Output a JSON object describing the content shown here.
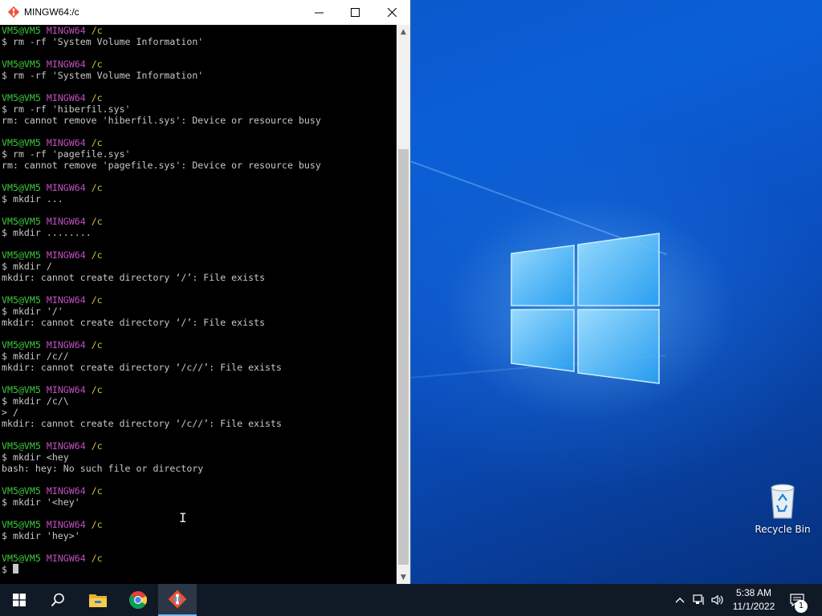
{
  "window": {
    "title": "MINGW64:/c",
    "minimize_icon": "minimize-icon",
    "maximize_icon": "maximize-icon",
    "close_icon": "close-icon"
  },
  "terminal": {
    "prompt": {
      "user": "VM5@VM5",
      "system": "MINGW64",
      "path": "/c"
    },
    "lines": [
      {
        "kind": "prompt"
      },
      {
        "kind": "text",
        "text": "$ rm -rf 'System Volume Information'"
      },
      {
        "kind": "blank"
      },
      {
        "kind": "prompt"
      },
      {
        "kind": "text",
        "text": "$ rm -rf 'System Volume Information'"
      },
      {
        "kind": "blank"
      },
      {
        "kind": "prompt"
      },
      {
        "kind": "text",
        "text": "$ rm -rf 'hiberfil.sys'"
      },
      {
        "kind": "text",
        "text": "rm: cannot remove 'hiberfil.sys': Device or resource busy"
      },
      {
        "kind": "blank"
      },
      {
        "kind": "prompt"
      },
      {
        "kind": "text",
        "text": "$ rm -rf 'pagefile.sys'"
      },
      {
        "kind": "text",
        "text": "rm: cannot remove 'pagefile.sys': Device or resource busy"
      },
      {
        "kind": "blank"
      },
      {
        "kind": "prompt"
      },
      {
        "kind": "text",
        "text": "$ mkdir ..."
      },
      {
        "kind": "blank"
      },
      {
        "kind": "prompt"
      },
      {
        "kind": "text",
        "text": "$ mkdir ........"
      },
      {
        "kind": "blank"
      },
      {
        "kind": "prompt"
      },
      {
        "kind": "text",
        "text": "$ mkdir /"
      },
      {
        "kind": "text",
        "text": "mkdir: cannot create directory ‘/’: File exists"
      },
      {
        "kind": "blank"
      },
      {
        "kind": "prompt"
      },
      {
        "kind": "text",
        "text": "$ mkdir '/'"
      },
      {
        "kind": "text",
        "text": "mkdir: cannot create directory ‘/’: File exists"
      },
      {
        "kind": "blank"
      },
      {
        "kind": "prompt"
      },
      {
        "kind": "text",
        "text": "$ mkdir /c//"
      },
      {
        "kind": "text",
        "text": "mkdir: cannot create directory ‘/c//’: File exists"
      },
      {
        "kind": "blank"
      },
      {
        "kind": "prompt"
      },
      {
        "kind": "text",
        "text": "$ mkdir /c/\\"
      },
      {
        "kind": "text",
        "text": "> /"
      },
      {
        "kind": "text",
        "text": "mkdir: cannot create directory ‘/c//’: File exists"
      },
      {
        "kind": "blank"
      },
      {
        "kind": "prompt"
      },
      {
        "kind": "text",
        "text": "$ mkdir <hey"
      },
      {
        "kind": "text",
        "text": "bash: hey: No such file or directory"
      },
      {
        "kind": "blank"
      },
      {
        "kind": "prompt"
      },
      {
        "kind": "text",
        "text": "$ mkdir '<hey'"
      },
      {
        "kind": "blank"
      },
      {
        "kind": "prompt"
      },
      {
        "kind": "text",
        "text": "$ mkdir 'hey>'"
      },
      {
        "kind": "blank"
      },
      {
        "kind": "prompt"
      },
      {
        "kind": "cursor",
        "text": "$ "
      }
    ]
  },
  "desktop": {
    "recycle_bin_label": "Recycle Bin",
    "recycle_bin_icon": "recycle-bin-icon",
    "logo_icon": "windows-logo-icon"
  },
  "taskbar": {
    "items": [
      {
        "name": "start-button",
        "icon": "windows-start-icon"
      },
      {
        "name": "search-button",
        "icon": "search-icon"
      },
      {
        "name": "file-explorer-button",
        "icon": "folder-icon"
      },
      {
        "name": "chrome-button",
        "icon": "chrome-icon"
      },
      {
        "name": "git-bash-button",
        "icon": "git-bash-icon",
        "active": true
      }
    ],
    "tray": {
      "time": "5:38 AM",
      "date": "11/1/2022",
      "notification_count": "1"
    }
  },
  "colors": {
    "prompt_user": "#3ec83e",
    "prompt_system": "#c24fc2",
    "prompt_path": "#c9c93a",
    "terminal_text": "#c8c8c8",
    "terminal_bg": "#000000",
    "taskbar_bg": "#101a26"
  }
}
